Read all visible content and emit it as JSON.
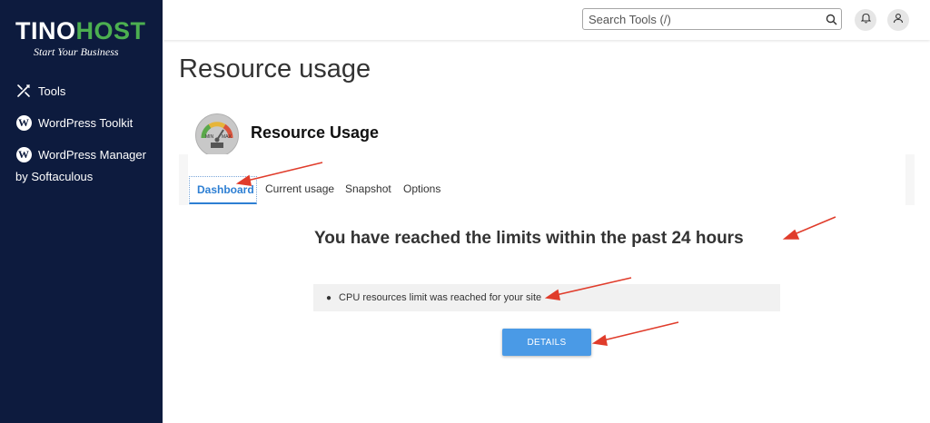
{
  "sidebar": {
    "logo": {
      "part1": "TINO",
      "part2": "HOST",
      "tagline": "Start Your Business"
    },
    "items": [
      {
        "label": "Tools",
        "icon": "tools-icon"
      },
      {
        "label": "WordPress Toolkit",
        "icon": "wordpress-icon"
      },
      {
        "label": "WordPress Manager",
        "icon": "wordpress-icon"
      }
    ],
    "items_sub": "by Softaculous"
  },
  "topbar": {
    "search_placeholder": "Search Tools (/)",
    "icons": [
      "search-icon",
      "bell-icon",
      "user-icon"
    ]
  },
  "main": {
    "page_title": "Resource usage",
    "section_title": "Resource Usage",
    "gauge": {
      "min_label": "MIN",
      "max_label": "MAX"
    },
    "tabs": [
      {
        "label": "Dashboard",
        "active": true
      },
      {
        "label": "Current usage",
        "active": false
      },
      {
        "label": "Snapshot",
        "active": false
      },
      {
        "label": "Options",
        "active": false
      }
    ],
    "headline": "You have reached the limits within the past 24 hours",
    "notice": "CPU resources limit was reached for your site",
    "details_button": "DETAILS"
  },
  "colors": {
    "sidebar_bg": "#0d1b3e",
    "logo_accent": "#4caf50",
    "tab_active": "#2d7fd3",
    "button_bg": "#4a9ae6",
    "annotation_arrow": "#e03c2b"
  }
}
